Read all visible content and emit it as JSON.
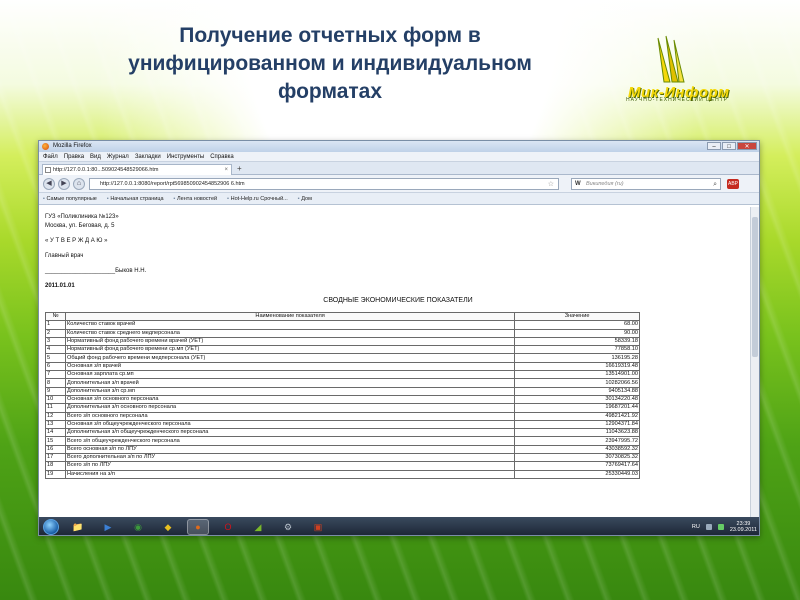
{
  "slide": {
    "title_lines": [
      "Получение отчетных форм в",
      "унифицированном и индивидуальном",
      "форматах"
    ],
    "logo": {
      "name": "Мик-Информ",
      "subtitle": "НАУЧНО-ТЕХНИЧЕСКИЙ ЦЕНТР"
    },
    "colors": {
      "title": "#243f66",
      "background_green": "#79c21d",
      "logo_yellow": "#f5d80a"
    }
  },
  "browser": {
    "window_title": "Mozilla Firefox",
    "window_controls": [
      "–",
      "□",
      "✕"
    ],
    "menu": [
      "Файл",
      "Правка",
      "Вид",
      "Журнал",
      "Закладки",
      "Инструменты",
      "Справка"
    ],
    "tab_label": "http://127.0.0.1:80...509024548529066.htm",
    "new_tab": "+",
    "url": "http://127.0.0.1:8080/report/rpt569850902454852906 6.htm",
    "search_engine": "W",
    "search_placeholder": "Википедия (ru)",
    "addon_label": "ABP",
    "bookmarks": [
      "Самые популярные",
      "Начальная страница",
      "Лента новостей",
      "Hot-Help.ru Срочный...",
      "Дом"
    ]
  },
  "document": {
    "org": "ГУЗ «Поликлиника №123»",
    "address": "Москва, ул. Беговая, д. 5",
    "approve": "« У Т В Е Р Ж Д А Ю »",
    "role": "Главный врач",
    "signature": "_____________________Быков Н.Н.",
    "date": "2011.01.01",
    "report_title": "СВОДНЫЕ ЭКОНОМИЧЕСКИЕ ПОКАЗАТЕЛИ",
    "columns": [
      "№",
      "Наименование показателя",
      "Значение"
    ],
    "rows": [
      {
        "n": "1",
        "name": "Количество ставок врачей",
        "value": "68.00"
      },
      {
        "n": "2",
        "name": "Количество ставок среднего медперсонала",
        "value": "90.00"
      },
      {
        "n": "3",
        "name": "Нормативный фонд рабочего времени врачей (УЕТ)",
        "value": "58339.18"
      },
      {
        "n": "4",
        "name": "Нормативный фонд рабочего времени ср.мп (УЕТ)",
        "value": "77858.10"
      },
      {
        "n": "5",
        "name": "Общий фонд рабочего времени медперсонала (УЕТ)",
        "value": "136195.28"
      },
      {
        "n": "6",
        "name": "Основная з/п врачей",
        "value": "16619319.48"
      },
      {
        "n": "7",
        "name": "Основная зарплата ср.мп",
        "value": "13514901.00"
      },
      {
        "n": "8",
        "name": "Дополнительная з/п врачей",
        "value": "10282066.56"
      },
      {
        "n": "9",
        "name": "Дополнительная з/п ср.мп",
        "value": "9405134.88"
      },
      {
        "n": "10",
        "name": "Основная з/п основного персонала",
        "value": "30134220.48"
      },
      {
        "n": "11",
        "name": "Дополнительная з/п основного персонала",
        "value": "19687201.44"
      },
      {
        "n": "12",
        "name": "Всего з/п основного персонала",
        "value": "49821421.92"
      },
      {
        "n": "13",
        "name": "Основная з/п общеучрежденческого персонала",
        "value": "12904371.84"
      },
      {
        "n": "14",
        "name": "Дополнительная з/п общеучрежденческого персонала",
        "value": "11043623.88"
      },
      {
        "n": "15",
        "name": "Всего з/п общеучрежденческого персонала",
        "value": "23947995.72"
      },
      {
        "n": "16",
        "name": "Всего основная з/п по ЛПУ",
        "value": "43038592.32"
      },
      {
        "n": "17",
        "name": "Всего дополнительная з/п по ЛПУ",
        "value": "30730825.32"
      },
      {
        "n": "18",
        "name": "Всего з/п по ЛПУ",
        "value": "73769417.64"
      },
      {
        "n": "19",
        "name": "Начисления на з/п",
        "value": "25330449.03"
      }
    ]
  },
  "taskbar": {
    "apps": [
      {
        "icon": "folder-icon",
        "glyph": "📁",
        "color": "#e8b54a"
      },
      {
        "icon": "media-player-icon",
        "glyph": "▶",
        "color": "#3b7fd4"
      },
      {
        "icon": "chrome-icon",
        "glyph": "◉",
        "color": "#3c9a3c"
      },
      {
        "icon": "yellow-app-icon",
        "glyph": "◆",
        "color": "#e8c020"
      },
      {
        "icon": "firefox-icon",
        "glyph": "●",
        "color": "#e06a1a"
      },
      {
        "icon": "opera-icon",
        "glyph": "O",
        "color": "#d0141c"
      },
      {
        "icon": "green-app-icon",
        "glyph": "◢",
        "color": "#7ab82a"
      },
      {
        "icon": "settings-icon",
        "glyph": "⚙",
        "color": "#b8c2cc"
      },
      {
        "icon": "office-icon",
        "glyph": "▣",
        "color": "#d04020"
      }
    ],
    "lang": "RU",
    "time": "23:39",
    "date": "23.09.2011"
  }
}
